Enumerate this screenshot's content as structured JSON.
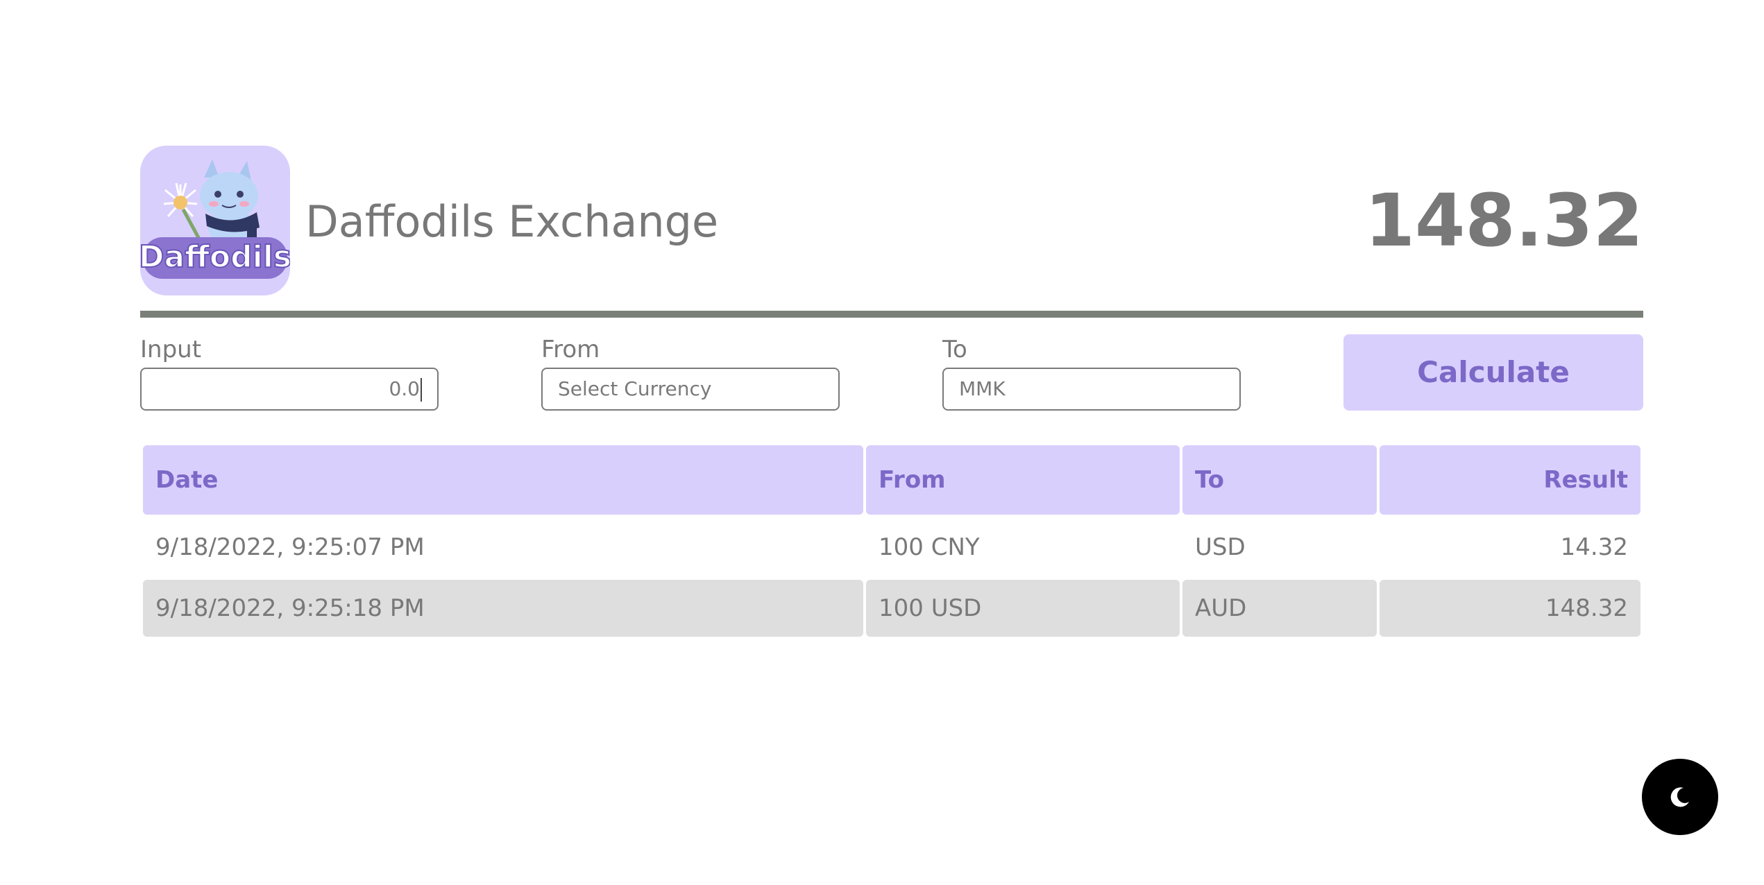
{
  "header": {
    "title": "Daffodils Exchange",
    "result": "148.32",
    "logo_text": "Daffodils"
  },
  "form": {
    "input": {
      "label": "Input",
      "value": "0.0"
    },
    "from": {
      "label": "From",
      "value": "Select Currency"
    },
    "to": {
      "label": "To",
      "value": "MMK"
    },
    "calculate_label": "Calculate"
  },
  "table": {
    "headers": {
      "date": "Date",
      "from": "From",
      "to": "To",
      "result": "Result"
    },
    "rows": [
      {
        "date": "9/18/2022, 9:25:07 PM",
        "from": "100 CNY",
        "to": "USD",
        "result": "14.32"
      },
      {
        "date": "9/18/2022, 9:25:18 PM",
        "from": "100 USD",
        "to": "AUD",
        "result": "148.32"
      }
    ]
  },
  "colors": {
    "accent": "#d9cffd",
    "accent_text": "#7c68c7",
    "text": "#787878",
    "divider": "#7a8078",
    "alt_row": "#dedede"
  },
  "icons": {
    "theme_toggle": "moon-icon"
  }
}
